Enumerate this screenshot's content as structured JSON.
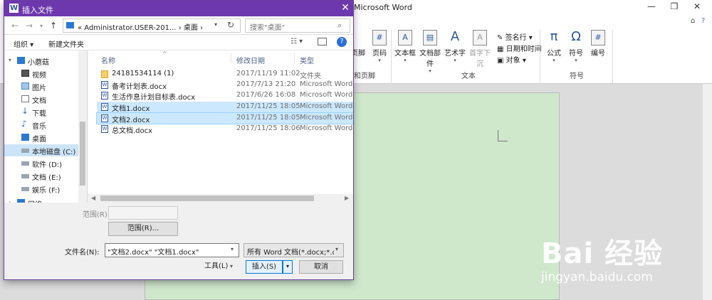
{
  "word": {
    "title": "Microsoft Word",
    "ribbon": {
      "left_items": [
        {
          "label": "页脚"
        },
        {
          "label": "页码"
        }
      ],
      "left_group": "和页脚",
      "items": [
        {
          "label": "文本框",
          "icon": "A"
        },
        {
          "label": "文档部件",
          "icon": "▤"
        },
        {
          "label": "艺术字",
          "icon": "A"
        },
        {
          "label": "首字下沉",
          "icon": "A"
        }
      ],
      "small_items": [
        "签名行",
        "日期和时间",
        "对象"
      ],
      "text_group": "文本",
      "symbol_items": [
        {
          "label": "公式",
          "icon": "π"
        },
        {
          "label": "符号",
          "icon": "Ω"
        },
        {
          "label": "编号",
          "icon": "#"
        }
      ],
      "symbol_group": "符号"
    }
  },
  "dialog": {
    "title": "插入文件",
    "title_icon": "W",
    "close": "✕",
    "address": "« Administrator.USER-201...  ›  桌面  ›",
    "search_placeholder": "搜索\"桌面\"",
    "toolbar": {
      "organize": "组织 ▾",
      "new_folder": "新建文件夹"
    },
    "nav_items": [
      {
        "label": "小蘑菇",
        "icon": "pc"
      },
      {
        "label": "视频",
        "icon": "video"
      },
      {
        "label": "图片",
        "icon": "picture"
      },
      {
        "label": "文档",
        "icon": "document"
      },
      {
        "label": "下载",
        "icon": "download"
      },
      {
        "label": "音乐",
        "icon": "music"
      },
      {
        "label": "桌面",
        "icon": "desktop"
      },
      {
        "label": "本地磁盘 (C:)",
        "icon": "drive"
      },
      {
        "label": "软件 (D:)",
        "icon": "drive"
      },
      {
        "label": "文档 (E:)",
        "icon": "drive"
      },
      {
        "label": "娱乐 (F:)",
        "icon": "drive"
      },
      {
        "label": "网络",
        "icon": "network"
      }
    ],
    "columns": {
      "name": "名称",
      "date": "修改日期",
      "type": "类型"
    },
    "files": [
      {
        "name": "24181534114 (1)",
        "date": "2017/11/19 11:02",
        "type": "文件夹",
        "kind": "folder",
        "selected": false
      },
      {
        "name": "备考计划表.docx",
        "date": "2017/7/13 21:20",
        "type": "Microsoft Word ...",
        "kind": "docx",
        "selected": false
      },
      {
        "name": "生活作息计划目标表.docx",
        "date": "2017/6/26 16:08",
        "type": "Microsoft Word ...",
        "kind": "docx",
        "selected": false
      },
      {
        "name": "文档1.docx",
        "date": "2017/11/25 18:05",
        "type": "Microsoft Word ...",
        "kind": "docx",
        "selected": true
      },
      {
        "name": "文档2.docx",
        "date": "2017/11/25 18:05",
        "type": "Microsoft Word ...",
        "kind": "docx",
        "selected": true
      },
      {
        "name": "总文档.docx",
        "date": "2017/11/25 18:06",
        "type": "Microsoft Word ...",
        "kind": "docx",
        "selected": false
      }
    ],
    "range_label": "范围(R):",
    "range_button": "范围(R)...",
    "filename_label": "文件名(N):",
    "filename_value": "\"文档2.docx\" \"文档1.docx\"",
    "filetype_value": "所有 Word 文档(*.docx;*.docx",
    "tools_button": "工具(L)",
    "insert_button": "插入(S)",
    "cancel_button": "取消"
  },
  "watermark": {
    "logo": "Bai 经验",
    "url": "jingyan.baidu.com"
  }
}
